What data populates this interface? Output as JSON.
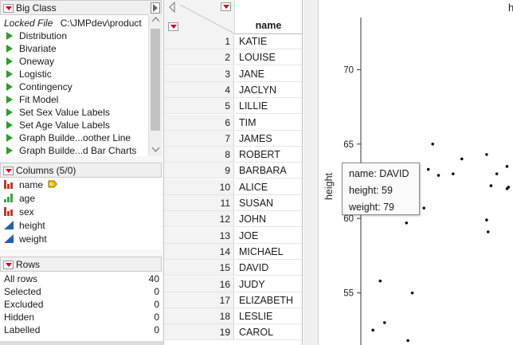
{
  "table_panel": {
    "title": "Big Class",
    "locked_label": "Locked File",
    "file_path": "C:\\JMPdev\\product",
    "scripts": [
      "Distribution",
      "Bivariate",
      "Oneway",
      "Logistic",
      "Contingency",
      "Fit Model",
      "Set Sex Value Labels",
      "Set Age Value Labels",
      "Graph Builde...oother Line",
      "Graph Builde...d Bar Charts"
    ]
  },
  "columns_panel": {
    "title": "Columns (5/0)",
    "columns": [
      {
        "name": "name",
        "icon": "nominal-bar-icon"
      },
      {
        "name": "age",
        "icon": "ordinal-bar-icon"
      },
      {
        "name": "sex",
        "icon": "nominal-bar-icon"
      },
      {
        "name": "height",
        "icon": "continuous-icon"
      },
      {
        "name": "weight",
        "icon": "continuous-icon"
      }
    ]
  },
  "rows_panel": {
    "title": "Rows",
    "rows": [
      {
        "label": "All rows",
        "value": "40"
      },
      {
        "label": "Selected",
        "value": "0"
      },
      {
        "label": "Excluded",
        "value": "0"
      },
      {
        "label": "Hidden",
        "value": "0"
      },
      {
        "label": "Labelled",
        "value": "0"
      }
    ]
  },
  "data_table": {
    "column_header": "name",
    "rows": [
      {
        "num": "1",
        "name": "KATIE"
      },
      {
        "num": "2",
        "name": "LOUISE"
      },
      {
        "num": "3",
        "name": "JANE"
      },
      {
        "num": "4",
        "name": "JACLYN"
      },
      {
        "num": "5",
        "name": "LILLIE"
      },
      {
        "num": "6",
        "name": "TIM"
      },
      {
        "num": "7",
        "name": "JAMES"
      },
      {
        "num": "8",
        "name": "ROBERT"
      },
      {
        "num": "9",
        "name": "BARBARA"
      },
      {
        "num": "10",
        "name": "ALICE"
      },
      {
        "num": "11",
        "name": "SUSAN"
      },
      {
        "num": "12",
        "name": "JOHN"
      },
      {
        "num": "13",
        "name": "JOE"
      },
      {
        "num": "14",
        "name": "MICHAEL"
      },
      {
        "num": "15",
        "name": "DAVID"
      },
      {
        "num": "16",
        "name": "JUDY"
      },
      {
        "num": "17",
        "name": "ELIZABETH"
      },
      {
        "num": "18",
        "name": "LESLIE"
      },
      {
        "num": "19",
        "name": "CAROL"
      }
    ]
  },
  "graph": {
    "title_partial": "h",
    "y_axis_label": "height",
    "y_ticks": [
      70,
      65,
      60,
      55
    ],
    "y_range": [
      51.5,
      73.5
    ],
    "x_range": [
      0,
      1
    ],
    "points": [
      {
        "x": 0.46,
        "y": 65.0
      },
      {
        "x": 0.66,
        "y": 64.0
      },
      {
        "x": 0.83,
        "y": 64.3
      },
      {
        "x": 0.97,
        "y": 63.5
      },
      {
        "x": 0.43,
        "y": 63.3
      },
      {
        "x": 0.9,
        "y": 63.0
      },
      {
        "x": 0.5,
        "y": 62.9
      },
      {
        "x": 0.6,
        "y": 63.0
      },
      {
        "x": 0.86,
        "y": 62.2
      },
      {
        "x": 0.98,
        "y": 62.1
      },
      {
        "x": 0.97,
        "y": 62.0
      },
      {
        "x": 0.34,
        "y": 62.5
      },
      {
        "x": 0.28,
        "y": 61.9
      },
      {
        "x": 0.4,
        "y": 60.7
      },
      {
        "x": 0.1,
        "y": 55.8
      },
      {
        "x": 0.32,
        "y": 55.0
      },
      {
        "x": 0.83,
        "y": 59.9
      },
      {
        "x": 0.84,
        "y": 59.1
      },
      {
        "x": 0.24,
        "y": 60.6
      },
      {
        "x": 0.28,
        "y": 59.7
      },
      {
        "x": 0.13,
        "y": 53.0
      },
      {
        "x": 0.05,
        "y": 52.5
      },
      {
        "x": 0.29,
        "y": 51.8
      }
    ]
  },
  "tooltip": {
    "name_line": "name: DAVID",
    "height_line": "height: 59",
    "weight_line": "weight: 79"
  },
  "colors": {
    "accent_red": "#d0021b",
    "script_green": "#2e9c2e",
    "nominal_red": "#c0392b",
    "ordinal_green": "#3aa34a",
    "continuous_blue": "#2a5db0"
  }
}
